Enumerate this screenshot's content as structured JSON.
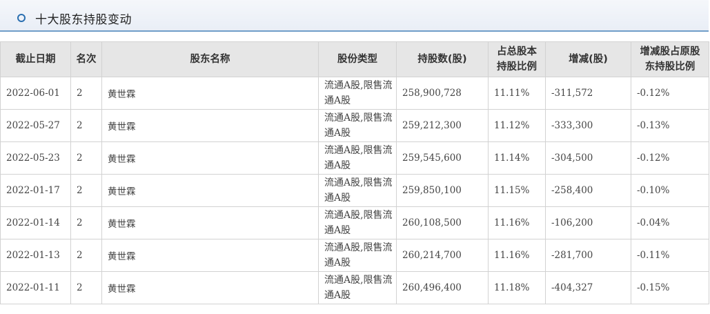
{
  "section": {
    "title": "十大股东持股变动"
  },
  "table": {
    "headers": {
      "date": "截止日期",
      "rank": "名次",
      "name": "股东名称",
      "type": "股份类型",
      "shares": "持股数(股)",
      "ratio_line1": "占总股本",
      "ratio_line2": "持股比例",
      "change": "增减(股)",
      "change_ratio_line1": "增减股占原股",
      "change_ratio_line2": "东持股比例"
    },
    "rows": [
      {
        "date": "2022-06-01",
        "rank": "2",
        "name": "黄世霖",
        "type": "流通A股,限售流通A股",
        "shares": "258,900,728",
        "ratio": "11.11%",
        "change": "-311,572",
        "change_ratio": "-0.12%"
      },
      {
        "date": "2022-05-27",
        "rank": "2",
        "name": "黄世霖",
        "type": "流通A股,限售流通A股",
        "shares": "259,212,300",
        "ratio": "11.12%",
        "change": "-333,300",
        "change_ratio": "-0.13%"
      },
      {
        "date": "2022-05-23",
        "rank": "2",
        "name": "黄世霖",
        "type": "流通A股,限售流通A股",
        "shares": "259,545,600",
        "ratio": "11.14%",
        "change": "-304,500",
        "change_ratio": "-0.12%"
      },
      {
        "date": "2022-01-17",
        "rank": "2",
        "name": "黄世霖",
        "type": "流通A股,限售流通A股",
        "shares": "259,850,100",
        "ratio": "11.15%",
        "change": "-258,400",
        "change_ratio": "-0.10%"
      },
      {
        "date": "2022-01-14",
        "rank": "2",
        "name": "黄世霖",
        "type": "流通A股,限售流通A股",
        "shares": "260,108,500",
        "ratio": "11.16%",
        "change": "-106,200",
        "change_ratio": "-0.04%"
      },
      {
        "date": "2022-01-13",
        "rank": "2",
        "name": "黄世霖",
        "type": "流通A股,限售流通A股",
        "shares": "260,214,700",
        "ratio": "11.16%",
        "change": "-281,700",
        "change_ratio": "-0.11%"
      },
      {
        "date": "2022-01-11",
        "rank": "2",
        "name": "黄世霖",
        "type": "流通A股,限售流通A股",
        "shares": "260,496,400",
        "ratio": "11.18%",
        "change": "-404,327",
        "change_ratio": "-0.15%"
      }
    ]
  },
  "colors": {
    "accent": "#2a6fb0",
    "divider": "#6f9dc8",
    "negative_change": "#2f9b2f",
    "header_bg": "#e6e6e6",
    "border": "#d2d2d2"
  },
  "icons": {
    "title_bullet": "circle-ring-icon"
  }
}
